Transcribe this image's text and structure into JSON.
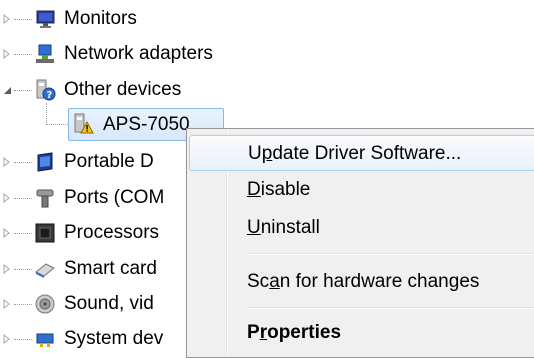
{
  "tree": {
    "items": [
      {
        "label": "Monitors",
        "icon": "monitor-icon",
        "expanded": false
      },
      {
        "label": "Network adapters",
        "icon": "network-adapter-icon",
        "expanded": false
      },
      {
        "label": "Other devices",
        "icon": "unknown-device-icon",
        "expanded": true
      },
      {
        "label": "APS-7050",
        "icon": "warning-device-icon",
        "selected": true
      },
      {
        "label": "Portable D",
        "icon": "portable-device-icon",
        "expanded": false
      },
      {
        "label": "Ports (COM",
        "icon": "port-icon",
        "expanded": false
      },
      {
        "label": "Processors",
        "icon": "processor-icon",
        "expanded": false
      },
      {
        "label": "Smart card",
        "icon": "smart-card-icon",
        "expanded": false
      },
      {
        "label": "Sound, vid",
        "icon": "sound-icon",
        "expanded": false
      },
      {
        "label": "System dev",
        "icon": "system-device-icon",
        "expanded": false
      }
    ]
  },
  "context_menu": {
    "items": [
      {
        "pre": "U",
        "accel": "p",
        "post": "date Driver Software...",
        "highlighted": true
      },
      {
        "pre": "",
        "accel": "D",
        "post": "isable"
      },
      {
        "pre": "",
        "accel": "U",
        "post": "ninstall"
      },
      {
        "pre": "Sc",
        "accel": "a",
        "post": "n for hardware changes"
      },
      {
        "pre": "P",
        "accel": "r",
        "post": "operties",
        "bold": true
      }
    ]
  },
  "colors": {
    "selection_border": "#86b9ed",
    "menu_background": "#f0f0f0",
    "menu_highlight_border": "#aecff7"
  }
}
